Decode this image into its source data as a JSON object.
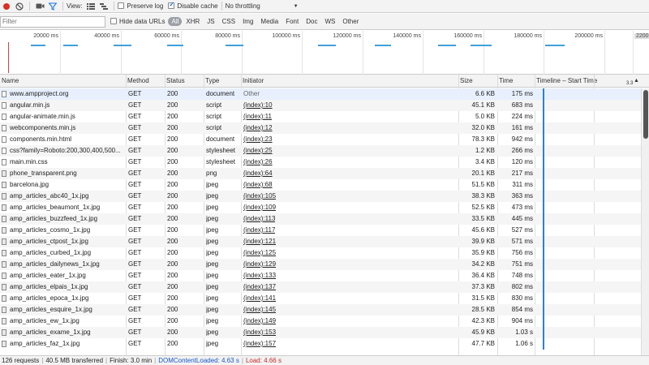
{
  "toolbar": {
    "view_label": "View:",
    "preserve_log_label": "Preserve log",
    "preserve_log_checked": false,
    "disable_cache_label": "Disable cache",
    "disable_cache_checked": true,
    "throttling_value": "No throttling"
  },
  "filter": {
    "placeholder": "Filter",
    "hide_data_urls_label": "Hide data URLs",
    "types": [
      "All",
      "XHR",
      "JS",
      "CSS",
      "Img",
      "Media",
      "Font",
      "Doc",
      "WS",
      "Other"
    ],
    "active_type": "All"
  },
  "overview": {
    "ticks": [
      "20000 ms",
      "40000 ms",
      "60000 ms",
      "80000 ms",
      "100000 ms",
      "120000 ms",
      "140000 ms",
      "160000 ms",
      "180000 ms",
      "200000 ms",
      "2200"
    ]
  },
  "columns": {
    "name": "Name",
    "method": "Method",
    "status": "Status",
    "type": "Type",
    "initiator": "Initiator",
    "size": "Size",
    "time": "Time",
    "timeline": "Timeline – Start Time",
    "timeline_scale": "3.3"
  },
  "rows": [
    {
      "name": "www.ampproject.org",
      "method": "GET",
      "status": "200",
      "type": "document",
      "initiator": "Other",
      "size": "6.6 KB",
      "time": "175 ms",
      "icon": "document-icon"
    },
    {
      "name": "angular.min.js",
      "method": "GET",
      "status": "200",
      "type": "script",
      "initiator": "(index):10",
      "size": "45.1 KB",
      "time": "683 ms",
      "icon": "script-file-icon"
    },
    {
      "name": "angular-animate.min.js",
      "method": "GET",
      "status": "200",
      "type": "script",
      "initiator": "(index):11",
      "size": "5.0 KB",
      "time": "224 ms",
      "icon": "script-file-icon"
    },
    {
      "name": "webcomponents.min.js",
      "method": "GET",
      "status": "200",
      "type": "script",
      "initiator": "(index):12",
      "size": "32.0 KB",
      "time": "161 ms",
      "icon": "script-file-icon"
    },
    {
      "name": "components.min.html",
      "method": "GET",
      "status": "200",
      "type": "document",
      "initiator": "(index):23",
      "size": "78.3 KB",
      "time": "942 ms",
      "icon": "document-icon"
    },
    {
      "name": "css?family=Roboto:200,300,400,500...",
      "method": "GET",
      "status": "200",
      "type": "stylesheet",
      "initiator": "(index):25",
      "size": "1.2 KB",
      "time": "266 ms",
      "icon": "stylesheet-icon"
    },
    {
      "name": "main.min.css",
      "method": "GET",
      "status": "200",
      "type": "stylesheet",
      "initiator": "(index):26",
      "size": "3.4 KB",
      "time": "120 ms",
      "icon": "stylesheet-icon"
    },
    {
      "name": "phone_transparent.png",
      "method": "GET",
      "status": "200",
      "type": "png",
      "initiator": "(index):64",
      "size": "20.1 KB",
      "time": "217 ms",
      "icon": "image-file-icon"
    },
    {
      "name": "barcelona.jpg",
      "method": "GET",
      "status": "200",
      "type": "jpeg",
      "initiator": "(index):68",
      "size": "51.5 KB",
      "time": "311 ms",
      "icon": "image-file-icon"
    },
    {
      "name": "amp_articles_abc40_1x.jpg",
      "method": "GET",
      "status": "200",
      "type": "jpeg",
      "initiator": "(index):105",
      "size": "38.3 KB",
      "time": "363 ms",
      "icon": "image-file-icon"
    },
    {
      "name": "amp_articles_beaumont_1x.jpg",
      "method": "GET",
      "status": "200",
      "type": "jpeg",
      "initiator": "(index):109",
      "size": "52.5 KB",
      "time": "473 ms",
      "icon": "image-file-icon"
    },
    {
      "name": "amp_articles_buzzfeed_1x.jpg",
      "method": "GET",
      "status": "200",
      "type": "jpeg",
      "initiator": "(index):113",
      "size": "33.5 KB",
      "time": "445 ms",
      "icon": "image-file-icon"
    },
    {
      "name": "amp_articles_cosmo_1x.jpg",
      "method": "GET",
      "status": "200",
      "type": "jpeg",
      "initiator": "(index):117",
      "size": "45.6 KB",
      "time": "527 ms",
      "icon": "image-file-icon"
    },
    {
      "name": "amp_articles_ctpost_1x.jpg",
      "method": "GET",
      "status": "200",
      "type": "jpeg",
      "initiator": "(index):121",
      "size": "39.9 KB",
      "time": "571 ms",
      "icon": "image-file-icon"
    },
    {
      "name": "amp_articles_curbed_1x.jpg",
      "method": "GET",
      "status": "200",
      "type": "jpeg",
      "initiator": "(index):125",
      "size": "35.9 KB",
      "time": "756 ms",
      "icon": "image-file-icon"
    },
    {
      "name": "amp_articles_dailynews_1x.jpg",
      "method": "GET",
      "status": "200",
      "type": "jpeg",
      "initiator": "(index):129",
      "size": "34.2 KB",
      "time": "751 ms",
      "icon": "image-file-icon"
    },
    {
      "name": "amp_articles_eater_1x.jpg",
      "method": "GET",
      "status": "200",
      "type": "jpeg",
      "initiator": "(index):133",
      "size": "36.4 KB",
      "time": "748 ms",
      "icon": "image-file-icon"
    },
    {
      "name": "amp_articles_elpais_1x.jpg",
      "method": "GET",
      "status": "200",
      "type": "jpeg",
      "initiator": "(index):137",
      "size": "37.3 KB",
      "time": "802 ms",
      "icon": "image-file-icon"
    },
    {
      "name": "amp_articles_epoca_1x.jpg",
      "method": "GET",
      "status": "200",
      "type": "jpeg",
      "initiator": "(index):141",
      "size": "31.5 KB",
      "time": "830 ms",
      "icon": "image-file-icon"
    },
    {
      "name": "amp_articles_esquire_1x.jpg",
      "method": "GET",
      "status": "200",
      "type": "jpeg",
      "initiator": "(index):145",
      "size": "28.5 KB",
      "time": "854 ms",
      "icon": "image-file-icon"
    },
    {
      "name": "amp_articles_ew_1x.jpg",
      "method": "GET",
      "status": "200",
      "type": "jpeg",
      "initiator": "(index):149",
      "size": "42.3 KB",
      "time": "904 ms",
      "icon": "image-file-icon"
    },
    {
      "name": "amp_articles_exame_1x.jpg",
      "method": "GET",
      "status": "200",
      "type": "jpeg",
      "initiator": "(index):153",
      "size": "45.9 KB",
      "time": "1.03 s",
      "icon": "image-file-icon"
    },
    {
      "name": "amp_articles_faz_1x.jpg",
      "method": "GET",
      "status": "200",
      "type": "jpeg",
      "initiator": "(index):157",
      "size": "47.7 KB",
      "time": "1.06 s",
      "icon": "image-file-icon"
    }
  ],
  "status": {
    "requests": "126 requests",
    "transferred": "40.5 MB transferred",
    "finish": "Finish: 3.0 min",
    "dom_content_loaded": "DOMContentLoaded: 4.63 s",
    "load": "Load: 4.66 s"
  }
}
